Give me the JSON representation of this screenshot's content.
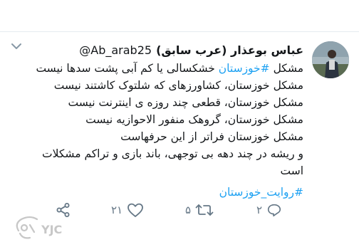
{
  "tweet": {
    "author_name": "عباس بوعذار (عرب سابق)",
    "author_handle": "@Ab_arab25",
    "lines": [
      {
        "prefix": "مشکل ",
        "hashtag": "#خوزستان",
        "suffix": " خشکسالی یا کم آبی پشت سدها نیست"
      },
      {
        "text": "مشکل خوزستان، کشاورزهای که شلتوک کاشتند نیست"
      },
      {
        "text": "مشکل خوزستان، قطعی چند روزه ی اینترنت نیست"
      },
      {
        "text": "مشکل خوزستان، گروهک منفور الاحوازیه نیست"
      },
      {
        "text": "مشکل خوزستان فراتر از این حرفهاست"
      },
      {
        "text": "و ریشه در چند دهه بی توجهی، باند بازی و تراکم مشکلات"
      },
      {
        "text": "است"
      }
    ],
    "hashtag_footer": "#روایت_خوزستان"
  },
  "actions": {
    "reply_count": "۲",
    "retweet_count": "۵",
    "like_count": "۲۱"
  },
  "watermark": {
    "text": "YJC"
  },
  "icons": {
    "caret": "chevron-down-icon",
    "reply": "reply-icon",
    "retweet": "retweet-icon",
    "like": "heart-icon",
    "share": "share-icon"
  },
  "colors": {
    "hashtag": "#1da1f2",
    "text": "#14171a",
    "muted": "#657786"
  }
}
